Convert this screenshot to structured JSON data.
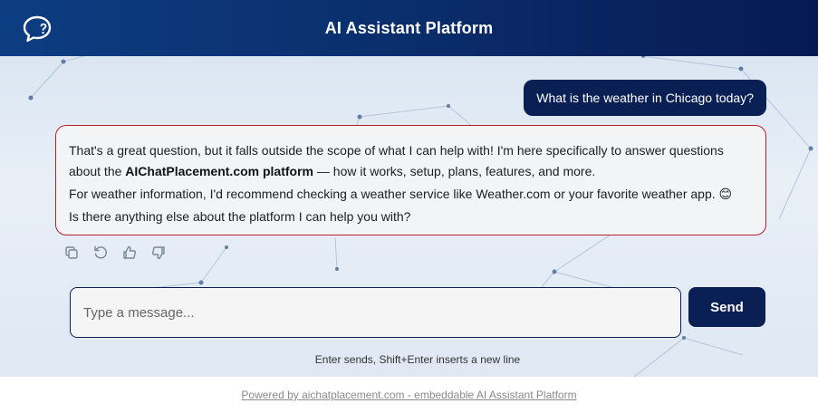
{
  "header": {
    "title": "AI Assistant Platform",
    "logo_icon": "chat-question-icon"
  },
  "colors": {
    "header_start": "#0d3d82",
    "header_end": "#061a52",
    "user_bubble": "#0a1f54",
    "bot_border": "#b5202a",
    "send_button": "#0a1f54"
  },
  "messages": {
    "user": "What is the weather in Chicago today?",
    "bot": {
      "line1_part1": "That's a great question, but it falls outside the scope of what I can help with! I'm here specifically to answer questions about the ",
      "line1_bold": "AIChatPlacement.com platform",
      "line1_part2": " — how it works, setup, plans, features, and more.",
      "line2": "For weather information, I'd recommend checking a weather service like Weather.com or your favorite weather app. 😊",
      "line3": "Is there anything else about the platform I can help you with?"
    }
  },
  "actions": {
    "items": [
      "copy-icon",
      "regenerate-icon",
      "thumbs-up-icon",
      "thumbs-down-icon"
    ]
  },
  "composer": {
    "placeholder": "Type a message...",
    "value": "",
    "send_label": "Send",
    "hint": "Enter sends, Shift+Enter inserts a new line"
  },
  "footer": {
    "link_text": "Powered by aichatplacement.com - embeddable AI Assistant Platform"
  }
}
